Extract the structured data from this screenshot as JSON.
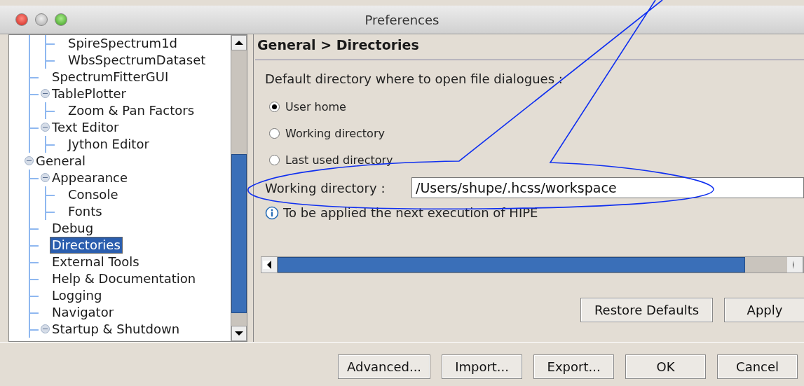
{
  "window": {
    "title": "Preferences"
  },
  "tree": {
    "items": [
      {
        "children": [
          {
            "children": [
              {
                "label": "SpireSpectrum1d",
                "selected": false
              },
              {
                "label": "WbsSpectrumDataset",
                "selected": false
              }
            ]
          },
          {
            "label": "SpectrumFitterGUI",
            "selected": false
          },
          {
            "label": "TablePlotter",
            "selected": false,
            "expanded": true,
            "children": [
              {
                "label": "Zoom & Pan Factors",
                "selected": false
              }
            ]
          },
          {
            "label": "Text Editor",
            "selected": false,
            "expanded": true,
            "children": [
              {
                "label": "Jython Editor",
                "selected": false
              }
            ]
          }
        ]
      },
      {
        "label": "General",
        "selected": false,
        "expanded": true,
        "children": [
          {
            "label": "Appearance",
            "selected": false,
            "expanded": true,
            "children": [
              {
                "label": "Console",
                "selected": false
              },
              {
                "label": "Fonts",
                "selected": false
              }
            ]
          },
          {
            "label": "Debug",
            "selected": false
          },
          {
            "label": "Directories",
            "selected": true
          },
          {
            "label": "External Tools",
            "selected": false
          },
          {
            "label": "Help & Documentation",
            "selected": false
          },
          {
            "label": "Logging",
            "selected": false
          },
          {
            "label": "Navigator",
            "selected": false
          },
          {
            "label": "Startup & Shutdown",
            "selected": false,
            "expanded": true
          }
        ]
      }
    ]
  },
  "page": {
    "breadcrumb": "General > Directories",
    "prompt": "Default directory where to open file dialogues :",
    "options": [
      {
        "label": "User home",
        "selected": true
      },
      {
        "label": "Working directory",
        "selected": false
      },
      {
        "label": "Last used directory",
        "selected": false
      }
    ],
    "field": {
      "label": "Working directory :",
      "value": "/Users/shupe/.hcss/workspace"
    },
    "info": "To be applied the next execution of HIPE",
    "buttons": [
      "Restore Defaults",
      "Apply"
    ]
  },
  "buttons": [
    "Advanced...",
    "Import...",
    "Export...",
    "OK",
    "Cancel"
  ]
}
